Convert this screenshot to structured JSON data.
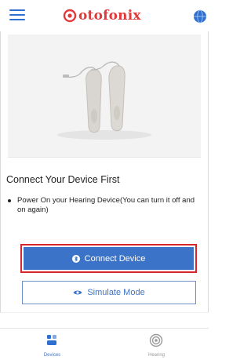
{
  "app": {
    "brand": "otofonix"
  },
  "header": {
    "menu_icon": "hamburger-menu-icon",
    "globe_icon": "globe-icon"
  },
  "hero": {
    "image": "hearing-aids-product-photo"
  },
  "connect_section": {
    "heading": "Connect Your Device First",
    "instructions": [
      "Power On your Hearing Device(You can turn it off and on again)"
    ]
  },
  "buttons": {
    "connect_label": "Connect Device",
    "connect_icon": "bluetooth-icon",
    "simulate_label": "Simulate Mode",
    "simulate_icon": "eye-icon"
  },
  "tabbar": {
    "tabs": [
      {
        "label": "Devices",
        "icon": "devices-icon",
        "active": true
      },
      {
        "label": "Hearing",
        "icon": "signal-icon",
        "active": false
      }
    ]
  },
  "colors": {
    "brand_red": "#e23a3a",
    "primary_blue": "#3b73c9",
    "highlight_outline": "#d6262b"
  }
}
